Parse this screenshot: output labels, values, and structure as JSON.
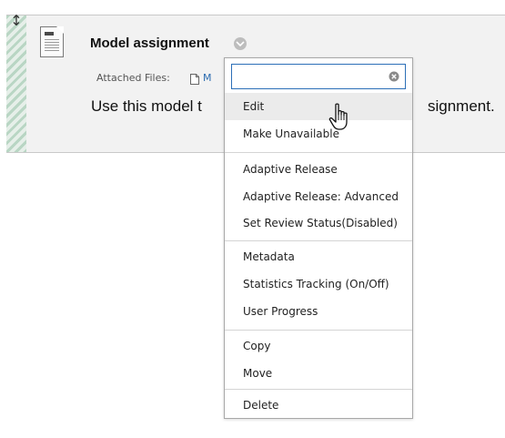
{
  "item": {
    "title": "Model assignment",
    "attached_label": "Attached Files:",
    "attached_file": "M",
    "description_left": "Use this model t",
    "description_right": "signment."
  },
  "menu": {
    "search_value": "",
    "search_placeholder": "",
    "items": [
      {
        "label": "Edit"
      },
      {
        "label": "Make Unavailable"
      },
      {
        "label": "Adaptive Release"
      },
      {
        "label": "Adaptive Release: Advanced"
      },
      {
        "label": "Set Review Status(Disabled)"
      },
      {
        "label": "Metadata"
      },
      {
        "label": "Statistics Tracking (On/Off)"
      },
      {
        "label": "User Progress"
      },
      {
        "label": "Copy"
      },
      {
        "label": "Move"
      },
      {
        "label": "Delete"
      }
    ]
  },
  "icons": {
    "drag": "drag-handle-icon",
    "document": "document-icon",
    "options": "chevron-down-icon",
    "file": "file-icon",
    "clear": "clear-icon",
    "cursor": "hand-pointer-icon"
  },
  "colors": {
    "link": "#2a6bb0",
    "search_border": "#2c6fb7",
    "hover_row": "#ebebeb",
    "item_background": "#f2f2f2"
  }
}
